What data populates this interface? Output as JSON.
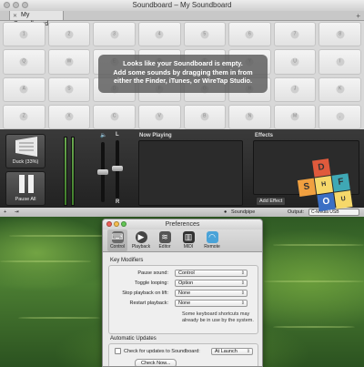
{
  "window": {
    "title": "Soundboard – My Soundboard",
    "tab_label": "My Soundboard",
    "tab_add": "+"
  },
  "grid": {
    "keys": [
      "1",
      "2",
      "3",
      "4",
      "5",
      "6",
      "7",
      "8",
      "Q",
      "W",
      "E",
      "R",
      "T",
      "Y",
      "U",
      "I",
      "A",
      "S",
      "D",
      "F",
      "G",
      "H",
      "J",
      "K",
      "Z",
      "X",
      "C",
      "V",
      "B",
      "N",
      "M",
      ","
    ]
  },
  "empty_message": {
    "line1": "Looks like your Soundboard is empty.",
    "line2": "Add some sounds by dragging them in from",
    "line3": "either the Finder, iTunes, or WireTap Studio."
  },
  "controls": {
    "duck_label": "Duck (33%)",
    "pause_all_label": "Pause All",
    "fader_left": "L",
    "fader_right": "R",
    "now_playing": "Now Playing",
    "effects": "Effects",
    "add_effect": "Add Effect"
  },
  "status": {
    "user": "Soundpipe",
    "output_label": "Output:",
    "output_value": "C-Media USB"
  },
  "note": {
    "letters": [
      "D",
      "S",
      "F",
      "H",
      "O",
      "U"
    ]
  },
  "prefs": {
    "title": "Preferences",
    "toolbar": [
      "Control",
      "Playback",
      "Editor",
      "MIDI",
      "Remote"
    ],
    "key_modifiers_title": "Key Modifiers",
    "rows": [
      {
        "label": "Pause sound:",
        "value": "Control"
      },
      {
        "label": "Toggle looping:",
        "value": "Option"
      },
      {
        "label": "Stop playback on lift:",
        "value": "None"
      },
      {
        "label": "Restart playback:",
        "value": "None"
      }
    ],
    "hint": "Some keyboard shortcuts may already be in use by the system.",
    "updates_title": "Automatic Updates",
    "check_label": "Check for updates to Soundboard:",
    "check_value": "At Launch",
    "check_now": "Check Now..."
  },
  "colors": {
    "meter_green": "#6aa84f",
    "panel_dark": "#2b2b2b",
    "note_orange": "#f0a040",
    "note_red": "#e05a3c",
    "note_teal": "#3fa8b5",
    "note_blue": "#3b6fc4"
  }
}
